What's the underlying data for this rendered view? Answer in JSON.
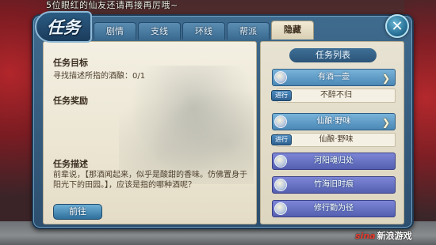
{
  "top_notice": "5位眼红的仙友还请再接再厉哦~",
  "window": {
    "title": "任务",
    "tabs": [
      {
        "label": "剧情",
        "active": false
      },
      {
        "label": "支线",
        "active": false
      },
      {
        "label": "环线",
        "active": false
      },
      {
        "label": "帮派",
        "active": false
      },
      {
        "label": "隐藏",
        "active": true
      }
    ],
    "close_icon": "close-icon"
  },
  "detail": {
    "goal_title": "任务目标",
    "goal_text": "寻找描述所指的酒酿：0/1",
    "reward_title": "任务奖励",
    "desc_title": "任务描述",
    "desc_text": "前辈说，【那酒闻起来，似乎是酸甜的香味。仿佛置身于阳光下的田园。】，应该是指的哪种酒呢？",
    "goto_label": "前往"
  },
  "quest_list": {
    "header": "任务列表",
    "items": [
      {
        "label": "有酒一壶",
        "style": "blue",
        "expanded": true
      },
      {
        "label": "不醉不归",
        "style": "sub",
        "badge": "进行"
      },
      {
        "label": "仙酿·野味",
        "style": "blue",
        "expanded": true
      },
      {
        "label": "仙酿·野味",
        "style": "sub",
        "badge": "进行"
      },
      {
        "label": "河阳魂归处",
        "style": "purple"
      },
      {
        "label": "竹海旧时痕",
        "style": "purple"
      },
      {
        "label": "修行勤为径",
        "style": "purple"
      }
    ]
  },
  "watermark": {
    "brand": "sina",
    "text": "新浪游戏"
  },
  "colors": {
    "tab_active_bg": "#f2ead5",
    "tab_bg": "#4a7aa0",
    "quest_blue": "#5f9ac5",
    "quest_purple": "#6872c4",
    "parchment": "#ede7d5"
  }
}
